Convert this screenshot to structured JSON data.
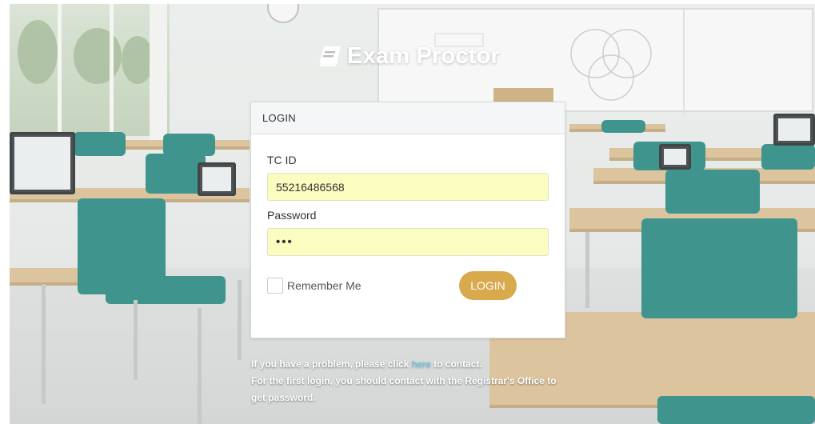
{
  "app": {
    "title": "Exam Proctor",
    "brand_icon": "book-icon"
  },
  "login_panel": {
    "heading": "LOGIN",
    "id_label": "TC ID",
    "id_value": "55216486568",
    "password_label": "Password",
    "password_mask": "•••",
    "remember_label": "Remember Me",
    "remember_checked": false,
    "submit_label": "LOGIN"
  },
  "help": {
    "line1_before": "If you have a problem, please click ",
    "line1_link": "here",
    "line1_after": " to contact.",
    "line2": "For the first login, you should contact with the Registrar's Office to get password."
  },
  "colors": {
    "input_background": "#fbfcbf",
    "button_background": "#d9a94d",
    "link": "#5ed0e8"
  }
}
